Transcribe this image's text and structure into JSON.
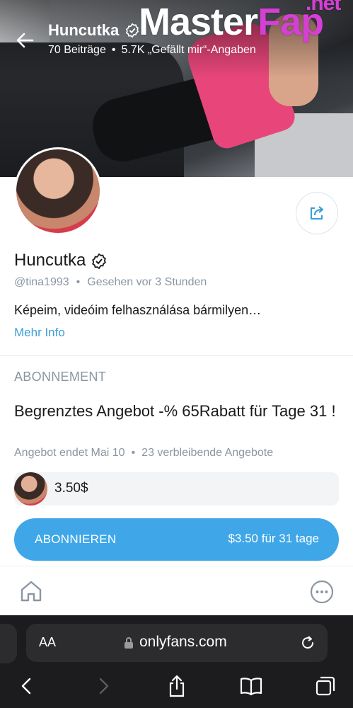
{
  "header": {
    "name": "Huncutka",
    "posts": "70 Beiträge",
    "likes": "5.7K „Gefällt mir“-Angaben",
    "separator": "•"
  },
  "watermark": {
    "master": "Master",
    "fap": "Fap",
    "net": ".net"
  },
  "profile": {
    "name": "Huncutka",
    "handle": "@tina1993",
    "last_seen": "Gesehen vor 3 Stunden",
    "bio": "Képeim, videóim felhasználása bármilyen…",
    "more_info": "Mehr Info"
  },
  "subscription": {
    "heading": "ABONNEMENT",
    "offer_title": "Begrenztes Angebot -% 65Rabatt für Tage 31 !",
    "offer_ends": "Angebot endet Mai 10",
    "offers_left": "23 verbleibende Angebote",
    "price": "3.50$",
    "button_label": "ABONNIEREN",
    "button_price": "$3.50 für 31 tage"
  },
  "browser": {
    "aa": "AA",
    "url": "onlyfans.com"
  },
  "colors": {
    "accent": "#3fa7e8",
    "link": "#3d9fd9",
    "muted": "#8a96a3",
    "watermark_pink": "#d63fd6"
  },
  "icons": [
    "back-arrow-icon",
    "verified-badge-icon",
    "share-icon",
    "home-icon",
    "more-dots-icon",
    "lock-icon",
    "reload-icon",
    "browser-back-icon",
    "browser-forward-icon",
    "browser-share-icon",
    "bookmarks-icon",
    "tabs-icon"
  ]
}
